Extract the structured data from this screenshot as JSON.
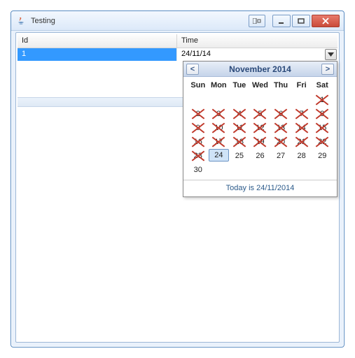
{
  "window": {
    "title": "Testing"
  },
  "table": {
    "columns": {
      "id": "Id",
      "time": "Time"
    },
    "row": {
      "id": "1",
      "time": "24/11/14"
    }
  },
  "calendar": {
    "month_label": "November 2014",
    "dow": [
      "Sun",
      "Mon",
      "Tue",
      "Wed",
      "Thu",
      "Fri",
      "Sat"
    ],
    "weeks": [
      [
        null,
        null,
        null,
        null,
        null,
        null,
        {
          "n": 1,
          "x": true
        }
      ],
      [
        {
          "n": 2,
          "x": true
        },
        {
          "n": 3,
          "x": true
        },
        {
          "n": 4,
          "x": true
        },
        {
          "n": 5,
          "x": true
        },
        {
          "n": 6,
          "x": true
        },
        {
          "n": 7,
          "x": true
        },
        {
          "n": 8,
          "x": true
        }
      ],
      [
        {
          "n": 9,
          "x": true
        },
        {
          "n": 10,
          "x": true
        },
        {
          "n": 11,
          "x": true
        },
        {
          "n": 12,
          "x": true
        },
        {
          "n": 13,
          "x": true
        },
        {
          "n": 14,
          "x": true
        },
        {
          "n": 15,
          "x": true
        }
      ],
      [
        {
          "n": 16,
          "x": true
        },
        {
          "n": 17,
          "x": true
        },
        {
          "n": 18,
          "x": true
        },
        {
          "n": 19,
          "x": true
        },
        {
          "n": 20,
          "x": true
        },
        {
          "n": 21,
          "x": true
        },
        {
          "n": 22,
          "x": true
        }
      ],
      [
        {
          "n": 23,
          "x": true
        },
        {
          "n": 24,
          "sel": true
        },
        {
          "n": 25
        },
        {
          "n": 26
        },
        {
          "n": 27
        },
        {
          "n": 28
        },
        {
          "n": 29
        }
      ],
      [
        {
          "n": 30
        },
        null,
        null,
        null,
        null,
        null,
        null
      ]
    ],
    "footer": "Today is 24/11/2014"
  }
}
